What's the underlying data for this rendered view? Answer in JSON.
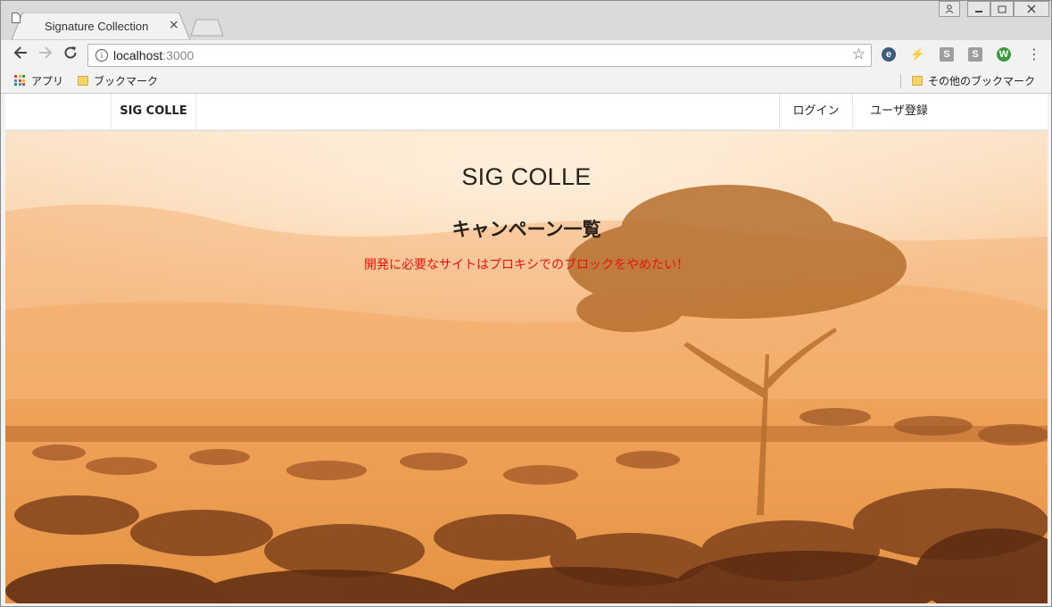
{
  "browser": {
    "tab_title": "Signature Collection",
    "tab_close": "×",
    "url_host": "localhost",
    "url_port": ":3000",
    "bookmarks": {
      "apps": "アプリ",
      "bookmarks": "ブックマーク",
      "other": "その他のブックマーク"
    },
    "extensions": [
      "e",
      "⚡",
      "S",
      "S",
      "W"
    ],
    "icons": {
      "back": "arrow-left-icon",
      "forward": "arrow-right-icon",
      "reload": "reload-icon",
      "info": "info-icon",
      "star": "star-icon",
      "menu": "kebab-menu-icon"
    }
  },
  "navbar": {
    "brand": "SIG COLLE",
    "login": "ログイン",
    "signup": "ユーザ登録"
  },
  "hero": {
    "site_title": "SIG COLLE",
    "list_title": "キャンペーン一覧",
    "notice": "開発に必要なサイトはプロキシでのブロックをやめたい！",
    "notice_color": "#e8130d"
  }
}
